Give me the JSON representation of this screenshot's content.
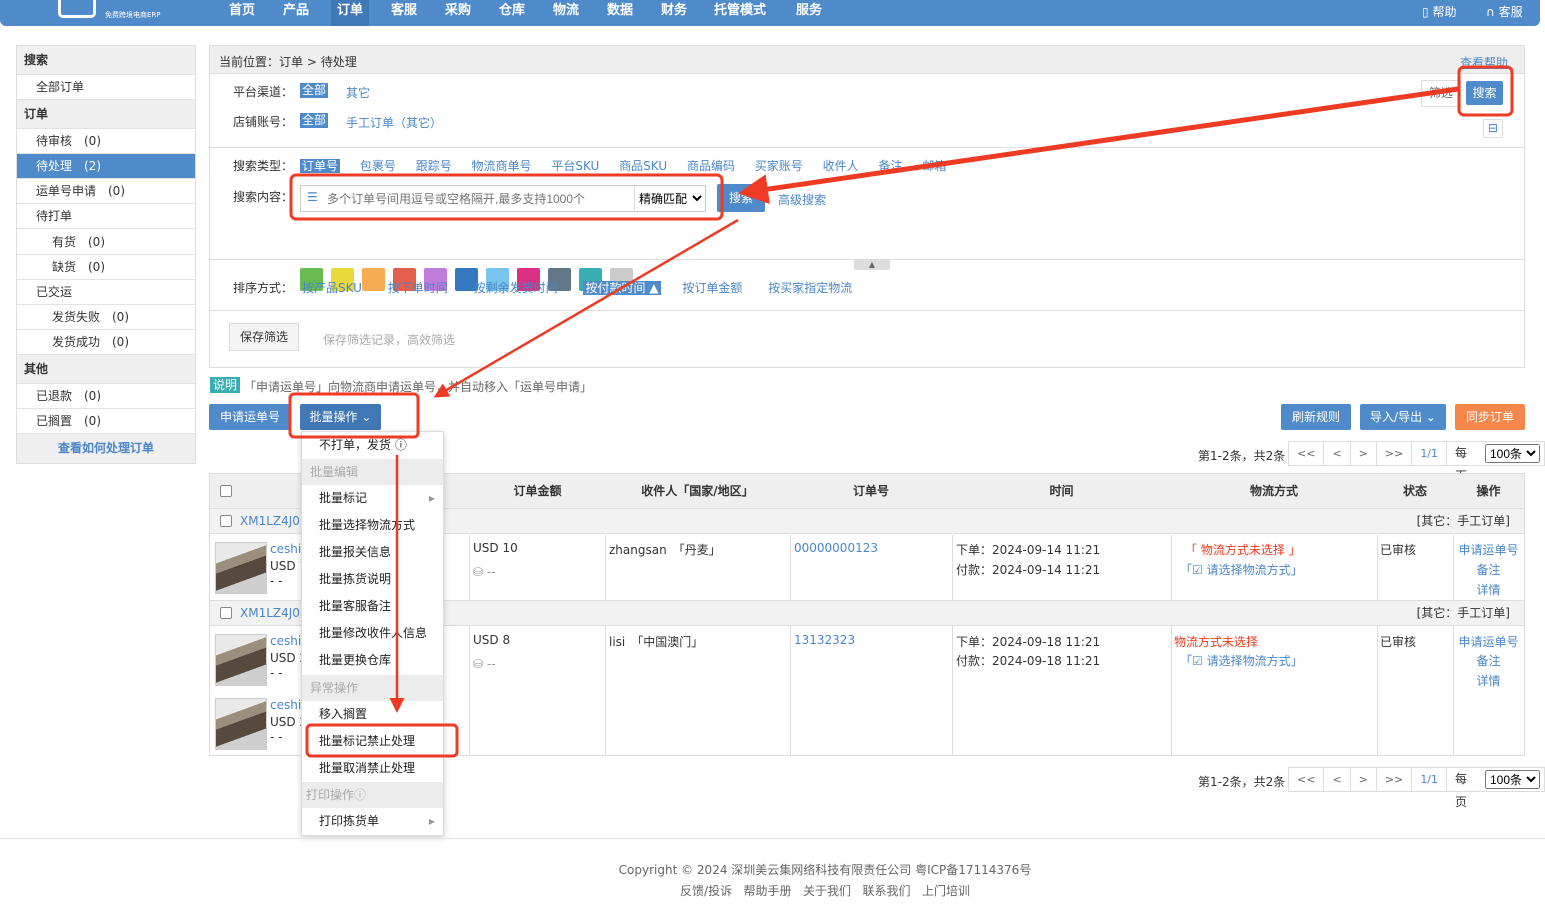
{
  "nav": {
    "logo_sub": "免费跨境电商ERP",
    "items": [
      "首页",
      "产品",
      "订单",
      "客服",
      "采购",
      "仓库",
      "物流",
      "数据",
      "财务",
      "托管模式",
      "服务"
    ],
    "active": "订单",
    "help": "帮助",
    "service": "客服"
  },
  "sidebar": {
    "search_header": "搜索",
    "all_orders": "全部订单",
    "order_header": "订单",
    "pending_review": "待审核　(0)",
    "pending": "待处理　(2)",
    "waybill_apply": "运单号申请　(0)",
    "to_print": "待打单",
    "in_stock": "有货　(0)",
    "out_stock": "缺货　(0)",
    "shipped": "已交运",
    "ship_fail": "发货失败　(0)",
    "ship_ok": "发货成功　(0)",
    "other_header": "其他",
    "refunded": "已退款　(0)",
    "shelved": "已搁置　(0)",
    "howto": "查看如何处理订单"
  },
  "panel": {
    "breadcrumb_label": "当前位置：",
    "breadcrumb_1": "订单",
    "breadcrumb_sep": ">",
    "breadcrumb_2": "待处理",
    "help_link": "查看帮助",
    "channel_label": "平台渠道：",
    "channel_all": "全部",
    "channel_other": "其它",
    "shop_label": "店铺账号：",
    "shop_all": "全部",
    "shop_manual": "手工订单（其它）",
    "filter_btn": "筛选",
    "search_btn": "搜索",
    "search_type_label": "搜索类型：",
    "search_types": [
      "订单号",
      "包裹号",
      "跟踪号",
      "物流商单号",
      "平台SKU",
      "商品SKU",
      "商品编码",
      "买家账号",
      "收件人",
      "备注",
      "邮箱"
    ],
    "search_content_label": "搜索内容：",
    "search_placeholder": "多个订单号间用逗号或空格隔开,最多支持1000个",
    "match_mode": "精确匹配",
    "search_go": "搜索",
    "advanced": "高级搜索",
    "colors": [
      "#6aba52",
      "#ead93a",
      "#f5ad52",
      "#e3604d",
      "#c07ddc",
      "#3478bf",
      "#79c4ea",
      "#da3182",
      "#627888",
      "#39aeb2",
      "#cbcbcb"
    ],
    "sort_label": "排序方式：",
    "sorts": [
      "按产品SKU",
      "按下单时间",
      "按剩余发货时间",
      "按付款时间 ▲",
      "按订单金额",
      "按买家指定物流"
    ],
    "save_filter": "保存筛选",
    "save_hint": "保存筛选记录，高效筛选"
  },
  "notice": {
    "badge": "说明",
    "text": "「申请运单号」向物流商申请运单号，并自动移入「运单号申请」"
  },
  "actions": {
    "apply": "申请运单号",
    "batch": "批量操作",
    "refresh": "刷新规则",
    "import_export": "导入/导出",
    "sync": "同步订单"
  },
  "pagination": {
    "summary": "第1-2条，共2条",
    "first": "<<",
    "prev": "<",
    "next": ">",
    "last": ">>",
    "page": "1/1",
    "per_page_label": "每页",
    "per_page": "100条"
  },
  "table": {
    "headers": [
      "订单金额",
      "收件人「国家/地区」",
      "订单号",
      "时间",
      "物流方式",
      "状态",
      "操作"
    ],
    "orders": [
      {
        "id": "XM1LZ4J01",
        "source": "[其它：手工订单]",
        "products": [
          {
            "name": "ceshi1",
            "price": "USD 1",
            "extra": "- -"
          }
        ],
        "amount": "USD 10",
        "fee": "--",
        "recipient": "zhangsan",
        "country": "「丹麦」",
        "order_no": "00000000123",
        "placed": "下单：2024-09-14 11:21",
        "paid": "付款：2024-09-14 11:21",
        "logistics": "「 物流方式未选择 」",
        "choose": "「☑ 请选择物流方式」",
        "status": "已审核",
        "ops": [
          "申请运单号",
          "备注",
          "详情"
        ]
      },
      {
        "id": "XM1LZ4J01",
        "source": "[其它：手工订单]",
        "products": [
          {
            "name": "ceshi1",
            "price": "USD 2",
            "extra": "- -"
          },
          {
            "name": "ceshi1",
            "price": "USD 2",
            "extra": "- -"
          }
        ],
        "amount": "USD 8",
        "fee": "--",
        "recipient": "lisi",
        "country": "「中国澳门」",
        "order_no": "13132323",
        "placed": "下单：2024-09-18 11:21",
        "paid": "付款：2024-09-18 11:21",
        "logistics": "物流方式未选择",
        "choose": "「☑ 请选择物流方式」",
        "status": "已审核",
        "ops": [
          "申请运单号",
          "备注",
          "详情"
        ]
      }
    ]
  },
  "menu": {
    "ship_no_print": "不打单，发货 ⓘ",
    "group_edit": "批量编辑",
    "edit_items": [
      "批量标记",
      "批量选择物流方式",
      "批量报关信息",
      "批量拣货说明",
      "批量客服备注",
      "批量修改收件人信息",
      "批量更换仓库"
    ],
    "group_exception": "异常操作",
    "exception_items": [
      "移入搁置",
      "批量标记禁止处理",
      "批量取消禁止处理"
    ],
    "group_print": "打印操作ⓘ",
    "print_items": [
      "打印拣货单"
    ]
  },
  "footer": {
    "copyright": "Copyright © 2024 深圳美云集网络科技有限责任公司 粤ICP备17114376号",
    "links": [
      "反馈/投诉",
      "帮助手册",
      "关于我们",
      "联系我们",
      "上门培训"
    ]
  }
}
